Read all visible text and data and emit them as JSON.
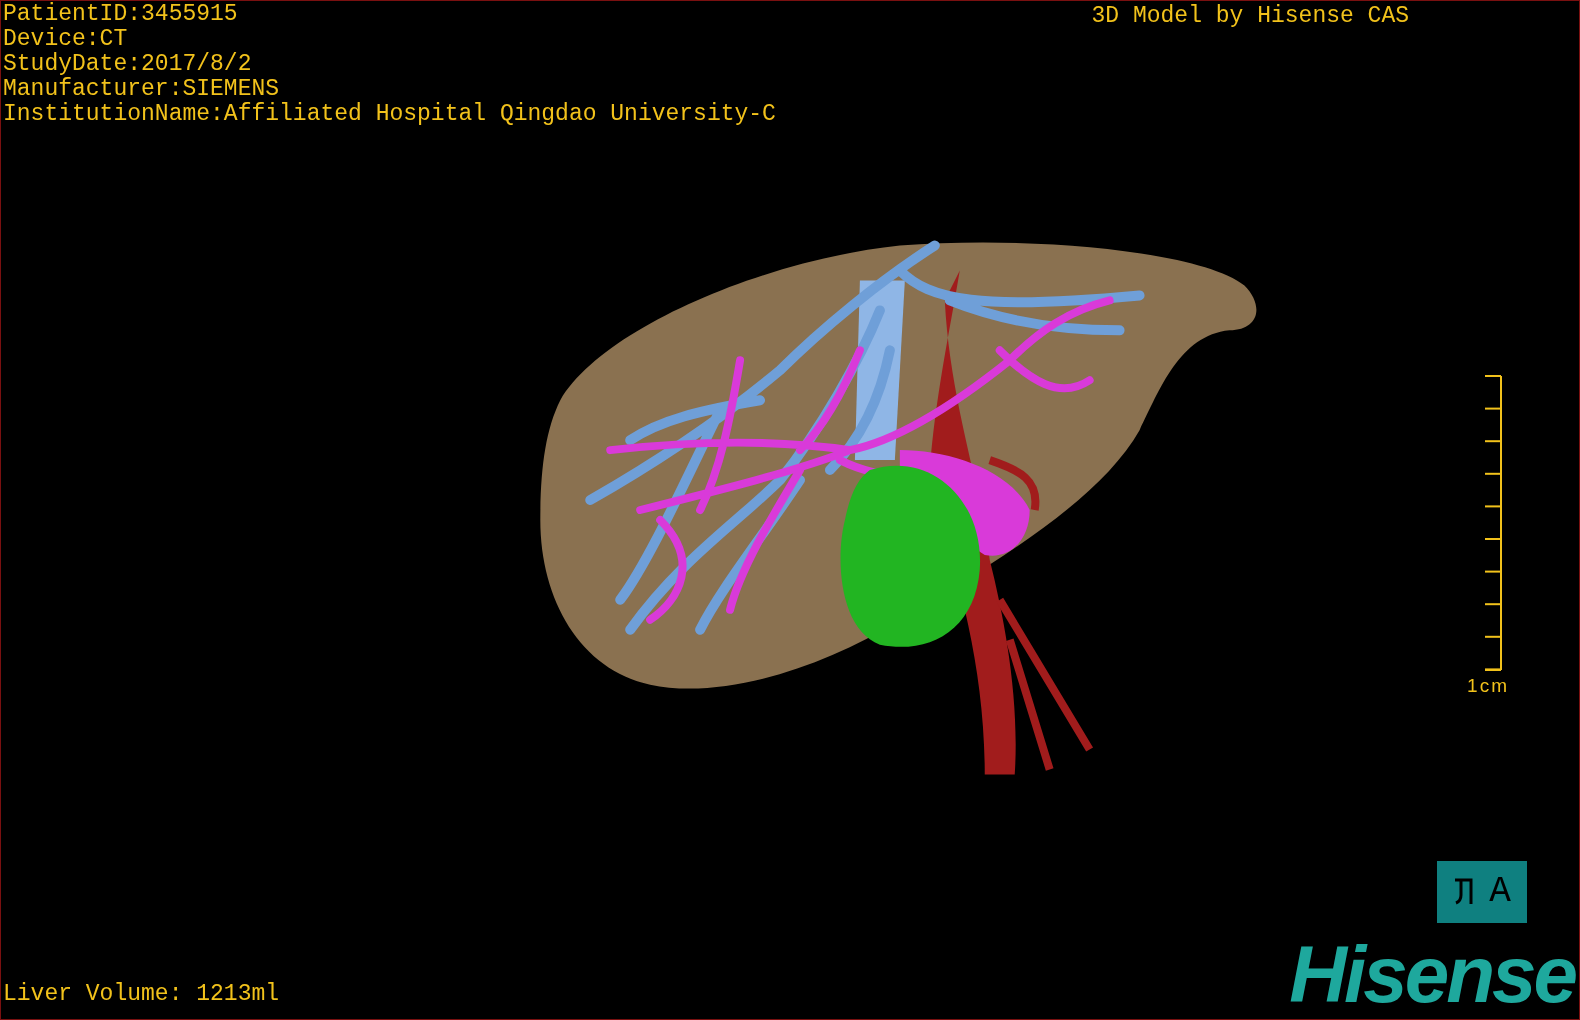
{
  "header": {
    "info_lines": [
      "PatientID:3455915",
      "Device:CT",
      "StudyDate:2017/8/2",
      "Manufacturer:SIEMENS",
      "InstitutionName:Affiliated Hospital Qingdao University-C"
    ],
    "title": "3D Model by Hisense CAS"
  },
  "scale_bar": {
    "label": "1cm"
  },
  "orientation_marker": {
    "label": "A"
  },
  "logo": {
    "text": "Hisense"
  },
  "footer": {
    "volume": "Liver Volume: 1213ml"
  }
}
